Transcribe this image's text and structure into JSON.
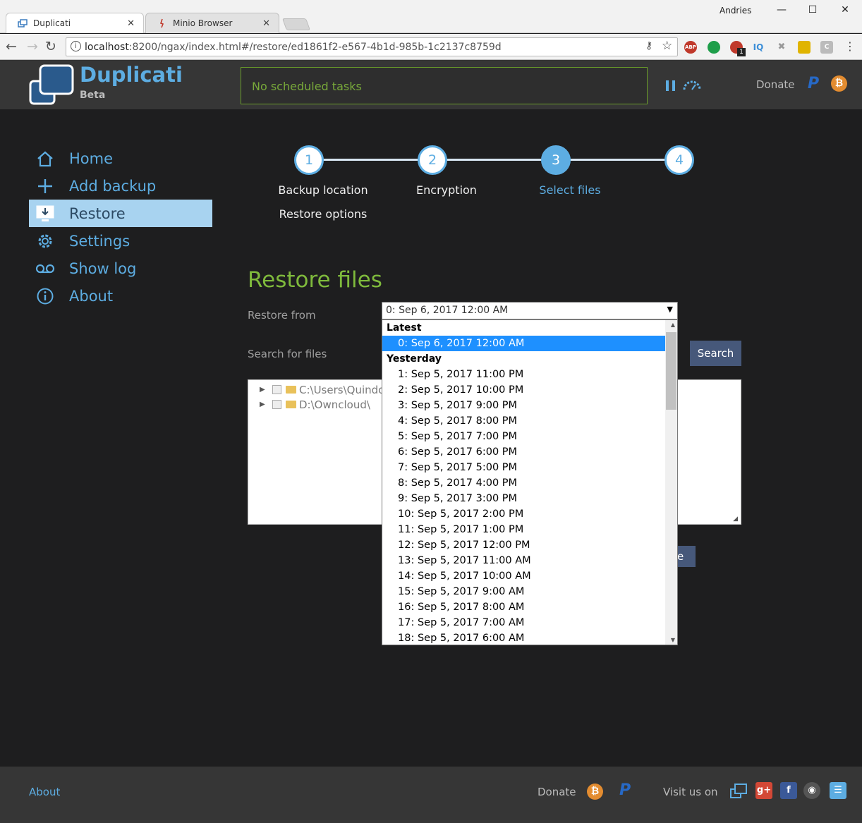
{
  "browser": {
    "tabs": [
      {
        "label": "Duplicati"
      },
      {
        "label": "Minio Browser"
      }
    ],
    "user": "Andries",
    "url_host": "localhost",
    "url_path": ":8200/ngax/index.html#/restore/ed1861f2-e567-4b1d-985b-1c2137c8759d",
    "extensions": [
      "ABP",
      "IQ",
      "C"
    ],
    "ext_badge": "1"
  },
  "header": {
    "brand": "Duplicati",
    "beta": "Beta",
    "status": "No scheduled tasks",
    "donate": "Donate"
  },
  "sidebar": {
    "items": [
      {
        "label": "Home",
        "icon": "home-icon"
      },
      {
        "label": "Add backup",
        "icon": "plus-icon"
      },
      {
        "label": "Restore",
        "icon": "restore-icon"
      },
      {
        "label": "Settings",
        "icon": "gear-icon"
      },
      {
        "label": "Show log",
        "icon": "voicemail-icon"
      },
      {
        "label": "About",
        "icon": "info-icon"
      }
    ],
    "active": "Restore"
  },
  "steps": {
    "nums": [
      "1",
      "2",
      "3",
      "4"
    ],
    "labels": [
      "Backup location",
      "Encryption",
      "Select files",
      "Restore options"
    ],
    "current": 3
  },
  "main": {
    "heading": "Restore files",
    "restore_from_label": "Restore from",
    "restore_from_value": "0: Sep 6, 2017 12:00 AM",
    "search_label": "Search for files",
    "search_button": "Search",
    "next_button_partial": "e",
    "tree": [
      {
        "label": "C:\\Users\\Quindo"
      },
      {
        "label": "D:\\Owncloud\\"
      }
    ]
  },
  "dropdown": {
    "groups": [
      {
        "label": "Latest",
        "options": [
          "0: Sep 6, 2017 12:00 AM"
        ]
      },
      {
        "label": "Yesterday",
        "options": [
          "1: Sep 5, 2017 11:00 PM",
          "2: Sep 5, 2017 10:00 PM",
          "3: Sep 5, 2017 9:00 PM",
          "4: Sep 5, 2017 8:00 PM",
          "5: Sep 5, 2017 7:00 PM",
          "6: Sep 5, 2017 6:00 PM",
          "7: Sep 5, 2017 5:00 PM",
          "8: Sep 5, 2017 4:00 PM",
          "9: Sep 5, 2017 3:00 PM",
          "10: Sep 5, 2017 2:00 PM",
          "11: Sep 5, 2017 1:00 PM",
          "12: Sep 5, 2017 12:00 PM",
          "13: Sep 5, 2017 11:00 AM",
          "14: Sep 5, 2017 10:00 AM",
          "15: Sep 5, 2017 9:00 AM",
          "16: Sep 5, 2017 8:00 AM",
          "17: Sep 5, 2017 7:00 AM",
          "18: Sep 5, 2017 6:00 AM"
        ]
      }
    ],
    "selected": "0: Sep 6, 2017 12:00 AM"
  },
  "footer": {
    "about": "About",
    "donate": "Donate",
    "visit": "Visit us on"
  },
  "colors": {
    "accent": "#5dade2",
    "green": "#7fba3c",
    "bg": "#1e1e1f",
    "header_bg": "#363636"
  }
}
